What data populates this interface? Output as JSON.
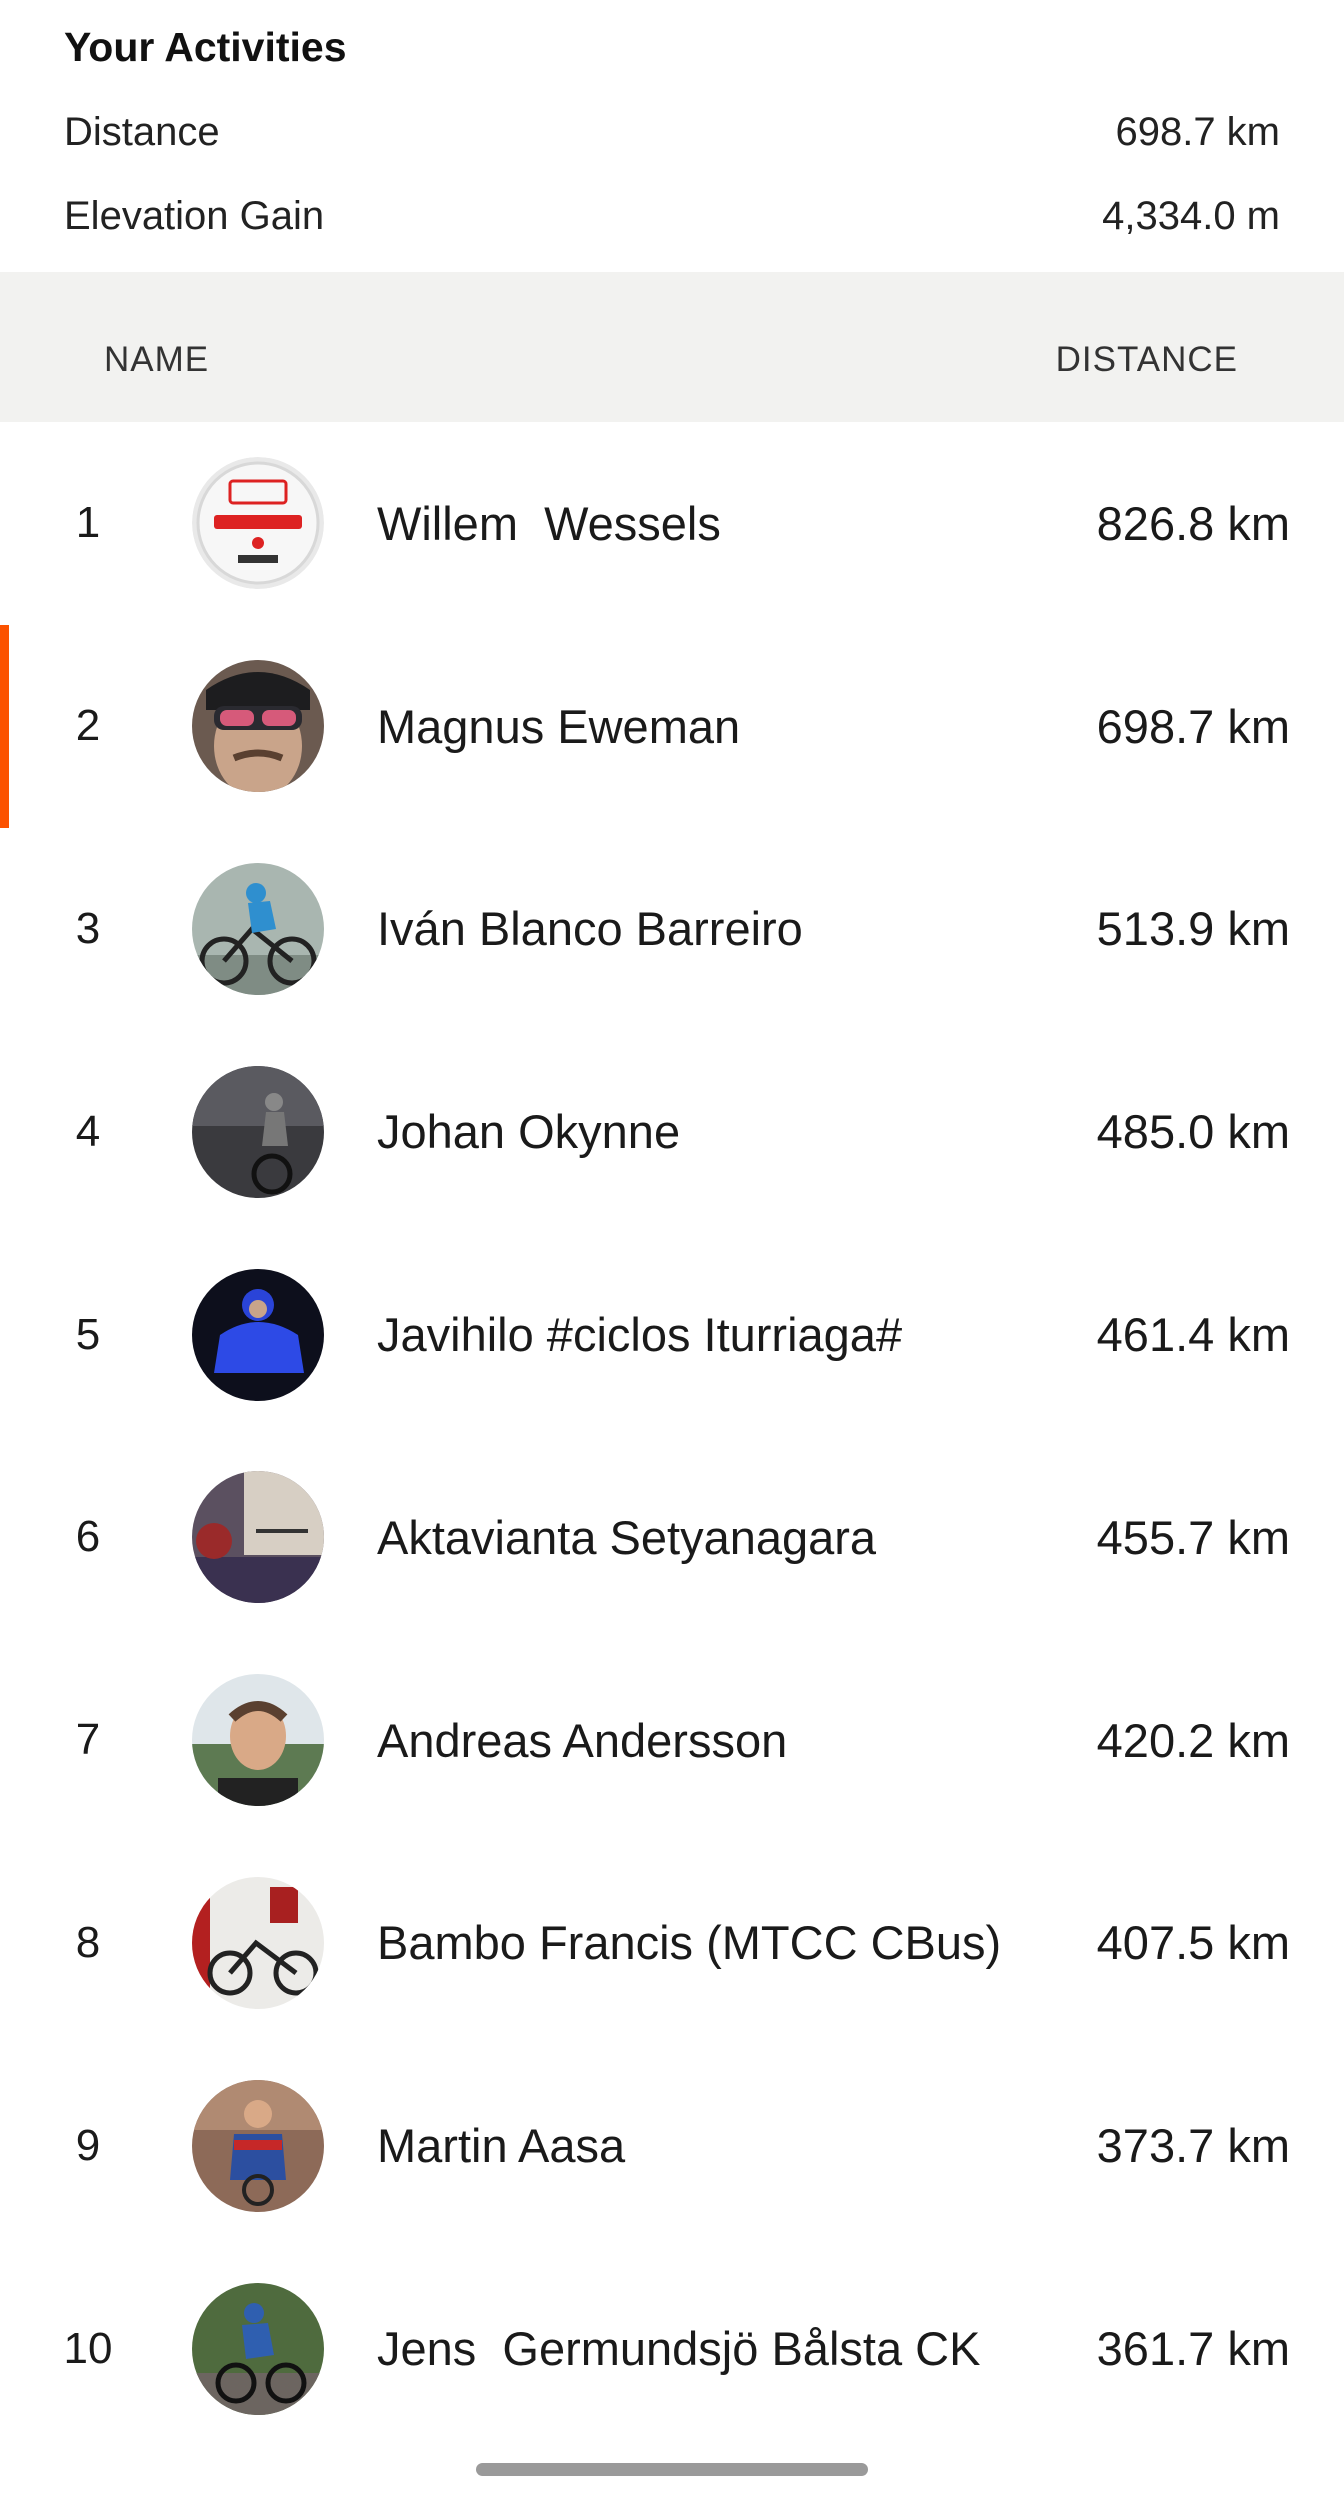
{
  "activities": {
    "title": "Your Activities",
    "distance_label": "Distance",
    "distance_value": "698.7 km",
    "elevation_label": "Elevation Gain",
    "elevation_value": "4,334.0 m"
  },
  "table": {
    "col_name": "NAME",
    "col_distance": "DISTANCE"
  },
  "rows": [
    {
      "rank": "1",
      "name": "Willem  Wessels",
      "distance": "826.8 km"
    },
    {
      "rank": "2",
      "name": "Magnus Eweman",
      "distance": "698.7 km",
      "current_user": true
    },
    {
      "rank": "3",
      "name": "Iván Blanco Barreiro",
      "distance": "513.9 km"
    },
    {
      "rank": "4",
      "name": "Johan Okynne",
      "distance": "485.0 km"
    },
    {
      "rank": "5",
      "name": "Javihilo #ciclos Iturriaga#",
      "distance": "461.4 km"
    },
    {
      "rank": "6",
      "name": "Aktavianta Setyanagara",
      "distance": "455.7 km"
    },
    {
      "rank": "7",
      "name": "Andreas Andersson",
      "distance": "420.2 km"
    },
    {
      "rank": "8",
      "name": "Bambo Francis (MTCC CBus)",
      "distance": "407.5 km"
    },
    {
      "rank": "9",
      "name": "Martin Aasa",
      "distance": "373.7 km"
    },
    {
      "rank": "10",
      "name": "Jens  Germundsjö Bålsta CK",
      "distance": "361.7 km"
    }
  ],
  "colors": {
    "accent": "#fc5200",
    "header_bg": "#f2f2f0"
  }
}
